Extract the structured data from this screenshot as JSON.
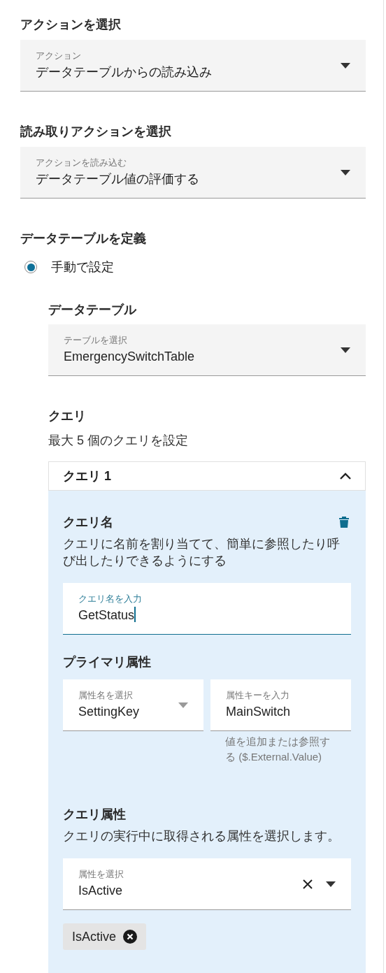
{
  "sections": [
    {
      "heading": "アクションを選択",
      "field": {
        "kind": "select",
        "label": "アクション",
        "value": "データテーブルからの読み込み"
      }
    },
    {
      "heading": "読み取りアクションを選択",
      "field": {
        "kind": "select",
        "label": "アクションを読み込む",
        "value": "データテーブル値の評価する"
      }
    }
  ],
  "define": {
    "heading": "データテーブルを定義",
    "options": [
      {
        "label": "手動で設定",
        "selected": true
      }
    ],
    "data_table": {
      "heading": "データテーブル",
      "field": {
        "kind": "select",
        "label": "テーブルを選択",
        "value": "EmergencySwitchTable"
      }
    },
    "queries": {
      "heading": "クエリ",
      "description": "最大 5 個のクエリを設定",
      "items": [
        {
          "title": "クエリ 1",
          "expanded": true,
          "name": {
            "heading": "クエリ名",
            "description": "クエリに名前を割り当てて、簡単に参照したり呼び出したりできるようにする",
            "field": {
              "kind": "input",
              "label": "クエリ名を入力",
              "value": "GetStatus",
              "focused": true
            }
          },
          "primary": {
            "heading": "プライマリ属性",
            "fields": [
              {
                "kind": "select",
                "label": "属性名を選択",
                "value": "SettingKey",
                "disabled": true
              },
              {
                "kind": "input",
                "label": "属性キーを入力",
                "value": "MainSwitch",
                "focused": false,
                "hint": "値を追加または参照する ($.External.Value)"
              }
            ]
          },
          "attributes": {
            "heading": "クエリ属性",
            "description": "クエリの実行中に取得される属性を選択します。",
            "field": {
              "kind": "select",
              "label": "属性を選択",
              "value": "IsActive",
              "clearable": true
            },
            "chips": [
              "IsActive"
            ]
          }
        }
      ]
    }
  }
}
